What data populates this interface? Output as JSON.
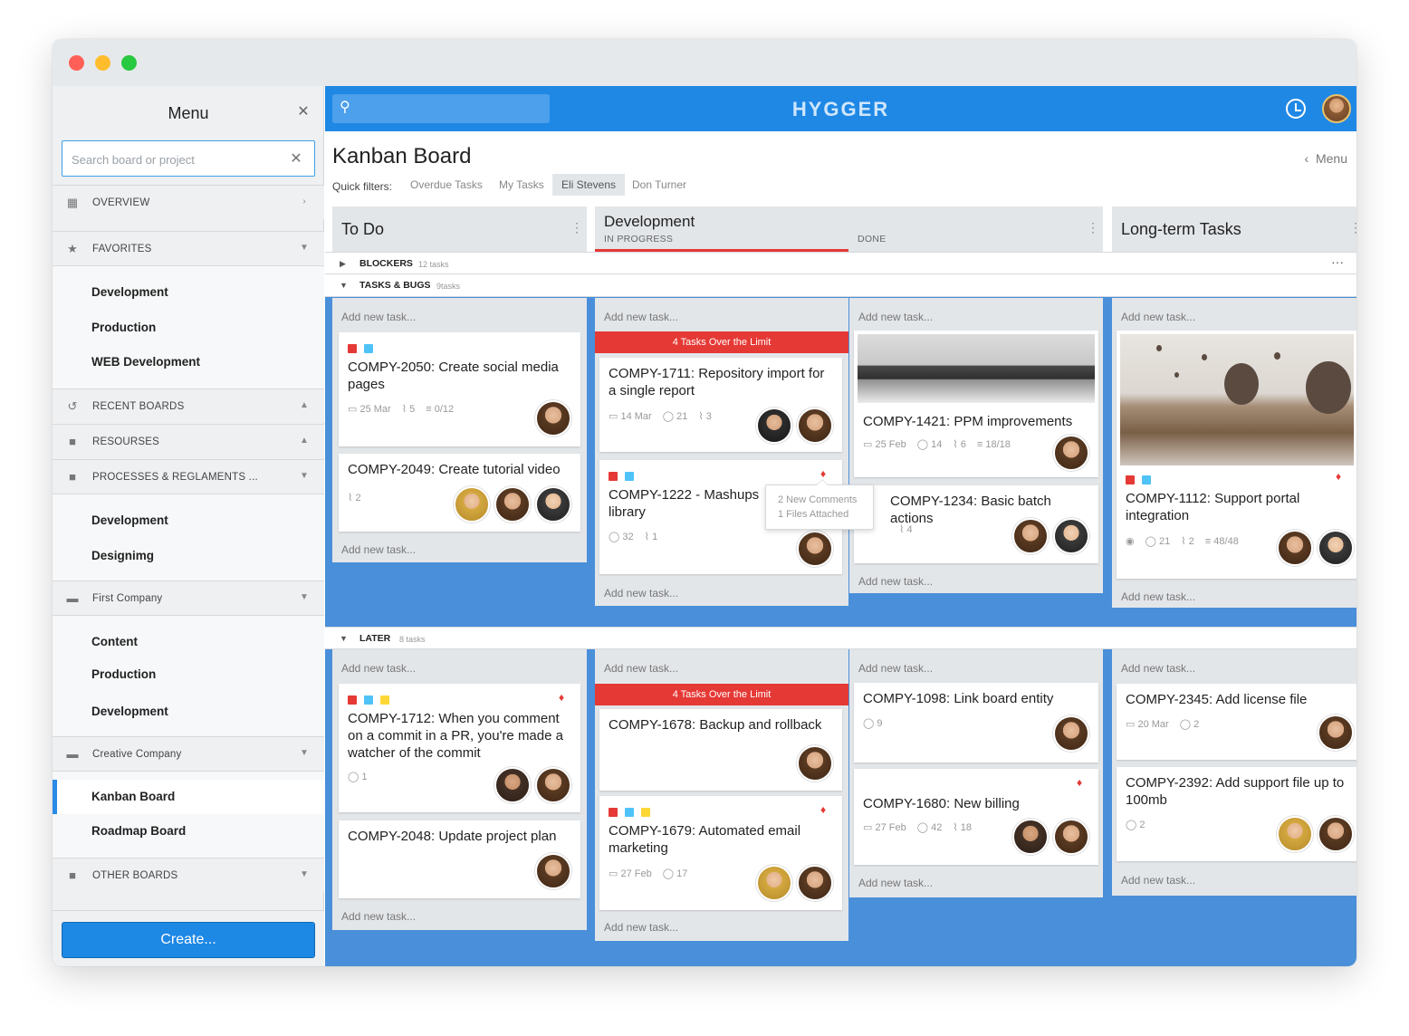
{
  "window": {
    "lights": {
      "red": "#ff5f57",
      "yellow": "#ffbd2e",
      "green": "#28c840"
    }
  },
  "sidebar": {
    "title": "Menu",
    "search_placeholder": "Search board or project",
    "sections": {
      "overview": "OVERVIEW",
      "favorites": "FAVORITES",
      "recent": "RECENT BOARDS",
      "resources": "RESOURSES",
      "processes": "PROCESSES & REGLAMENTS ...",
      "first_company": "First Company",
      "creative_company": "Creative Company",
      "other_boards": "OTHER BOARDS"
    },
    "favorites_items": [
      "Development",
      "Production",
      "WEB Development"
    ],
    "processes_items": [
      "Development",
      "Designimg"
    ],
    "first_company_items": [
      "Content",
      "Production",
      "Development"
    ],
    "creative_company_items": [
      "Kanban Board",
      "Roadmap Board"
    ],
    "create_label": "Create..."
  },
  "topbar": {
    "brand": "HYGGER"
  },
  "board": {
    "title": "Kanban Board",
    "menu_link": "Menu",
    "quick_filters_label": "Quick filters:",
    "quick_filters": [
      "Overdue Tasks",
      "My Tasks",
      "Eli Stevens",
      "Don Turner"
    ],
    "active_filter": "Eli Stevens",
    "columns": {
      "todo": "To Do",
      "development": "Development",
      "in_progress": "IN PROGRESS",
      "done": "DONE",
      "longterm": "Long-term Tasks"
    },
    "swimlanes": {
      "blockers": {
        "name": "BLOCKERS",
        "count": "12 tasks"
      },
      "tasks_bugs": {
        "name": "TASKS & BUGS",
        "count": "9tasks"
      },
      "later": {
        "name": "LATER",
        "count": "8 tasks"
      }
    },
    "add_task": "Add new task...",
    "over_limit": "4 Tasks Over the Limit",
    "tooltip": {
      "line1": "2 New Comments",
      "line2": "1 Files Attached"
    }
  },
  "colors": {
    "accent": "#1f88e5",
    "red": "#e53935",
    "tag_red": "#e53935",
    "tag_blue": "#4fc3f7",
    "tag_yellow": "#fdd835"
  },
  "cards": {
    "c2050": {
      "title": "COMPY-2050: Create social media pages",
      "date": "25 Mar",
      "attachments": "5",
      "checklist": "0/12"
    },
    "c2049": {
      "title": "COMPY-2049: Create tutorial video",
      "attachments": "2"
    },
    "c1711": {
      "title": "COMPY-1711: Repository import for a single report",
      "date": "14 Mar",
      "comments": "21",
      "attachments": "3"
    },
    "c1222": {
      "title": "COMPY-1222 - Mashups library",
      "comments": "32",
      "attachments": "1"
    },
    "c1421": {
      "title": "COMPY-1421: PPM improvements",
      "date": "25 Feb",
      "comments": "14",
      "attachments": "6",
      "checklist": "18/18"
    },
    "c1234": {
      "title": "COMPY-1234: Basic batch actions",
      "attachments": "4"
    },
    "c1112": {
      "title": "COMPY-1112: Support portal integration",
      "comments": "21",
      "attachments": "2",
      "checklist": "48/48"
    },
    "c1712": {
      "title": "COMPY-1712: When you comment on a commit in a PR, you're made a watcher of the commit",
      "comments": "1"
    },
    "c2048": {
      "title": "COMPY-2048: Update project plan"
    },
    "c1678": {
      "title": "COMPY-1678: Backup and rollback"
    },
    "c1679": {
      "title": "COMPY-1679: Automated email marketing",
      "date": "27 Feb",
      "comments": "17"
    },
    "c1098": {
      "title": "COMPY-1098: Link board entity",
      "comments": "9"
    },
    "c1680": {
      "title": "COMPY-1680: New billing",
      "date": "27 Feb",
      "comments": "42",
      "attachments": "18"
    },
    "c2345": {
      "title": "COMPY-2345: Add license file",
      "date": "20 Mar",
      "comments": "2"
    },
    "c2392": {
      "title": "COMPY-2392: Add support file up to 100mb",
      "comments": "2"
    }
  }
}
